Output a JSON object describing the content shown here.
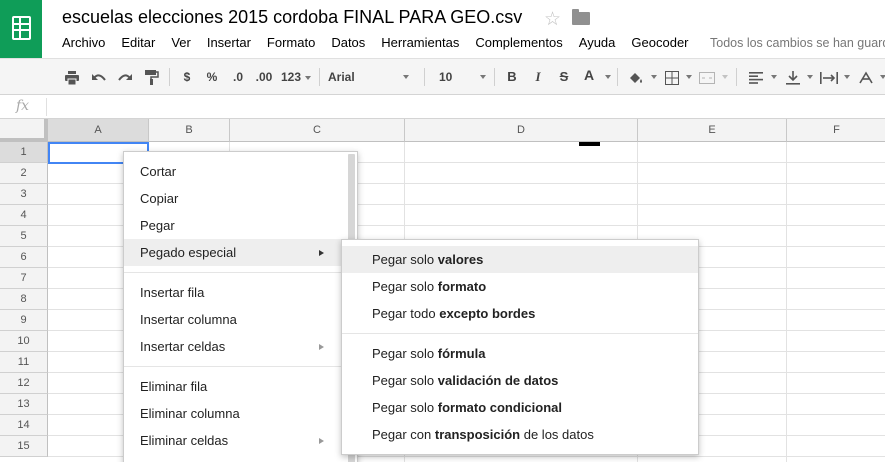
{
  "doc": {
    "title": "escuelas elecciones 2015 cordoba FINAL PARA GEO.csv",
    "save_status": "Todos los cambios se han guardado en Drive"
  },
  "menu": [
    "Archivo",
    "Editar",
    "Ver",
    "Insertar",
    "Formato",
    "Datos",
    "Herramientas",
    "Complementos",
    "Ayuda",
    "Geocoder"
  ],
  "toolbar": {
    "currency": "$",
    "percent": "%",
    "decrease_decimals": ".0",
    "increase_decimals": ".00",
    "more_formats": "123",
    "font": "Arial",
    "font_size": "10",
    "bold": "B",
    "italic": "I",
    "strikethrough": "S",
    "text_color": "A",
    "text_color_value": "#000000"
  },
  "formula_bar": {
    "fx": "fx",
    "value": ""
  },
  "columns": [
    "A",
    "B",
    "C",
    "D",
    "E",
    "F"
  ],
  "rows": [
    "1",
    "2",
    "3",
    "4",
    "5",
    "6",
    "7",
    "8",
    "9",
    "10",
    "11",
    "12",
    "13",
    "14",
    "15"
  ],
  "context_menu": {
    "cut": "Cortar",
    "copy": "Copiar",
    "paste": "Pegar",
    "paste_special": "Pegado especial",
    "insert_row": "Insertar fila",
    "insert_column": "Insertar columna",
    "insert_cells": "Insertar celdas",
    "delete_row": "Eliminar fila",
    "delete_column": "Eliminar columna",
    "delete_cells": "Eliminar celdas"
  },
  "paste_special": [
    {
      "prefix": "Pegar solo ",
      "bold": "valores",
      "suffix": ""
    },
    {
      "prefix": "Pegar solo ",
      "bold": "formato",
      "suffix": ""
    },
    {
      "prefix": "Pegar todo ",
      "bold": "excepto bordes",
      "suffix": ""
    },
    {
      "prefix": "Pegar solo ",
      "bold": "fórmula",
      "suffix": ""
    },
    {
      "prefix": "Pegar solo ",
      "bold": "validación de datos",
      "suffix": ""
    },
    {
      "prefix": "Pegar solo ",
      "bold": "formato condicional",
      "suffix": ""
    },
    {
      "prefix": "Pegar con ",
      "bold": "transposición",
      "suffix": " de los datos"
    }
  ],
  "colors": {
    "brand": "#0f9d58",
    "selection": "#4285f4",
    "hover": "#eeeeee"
  }
}
